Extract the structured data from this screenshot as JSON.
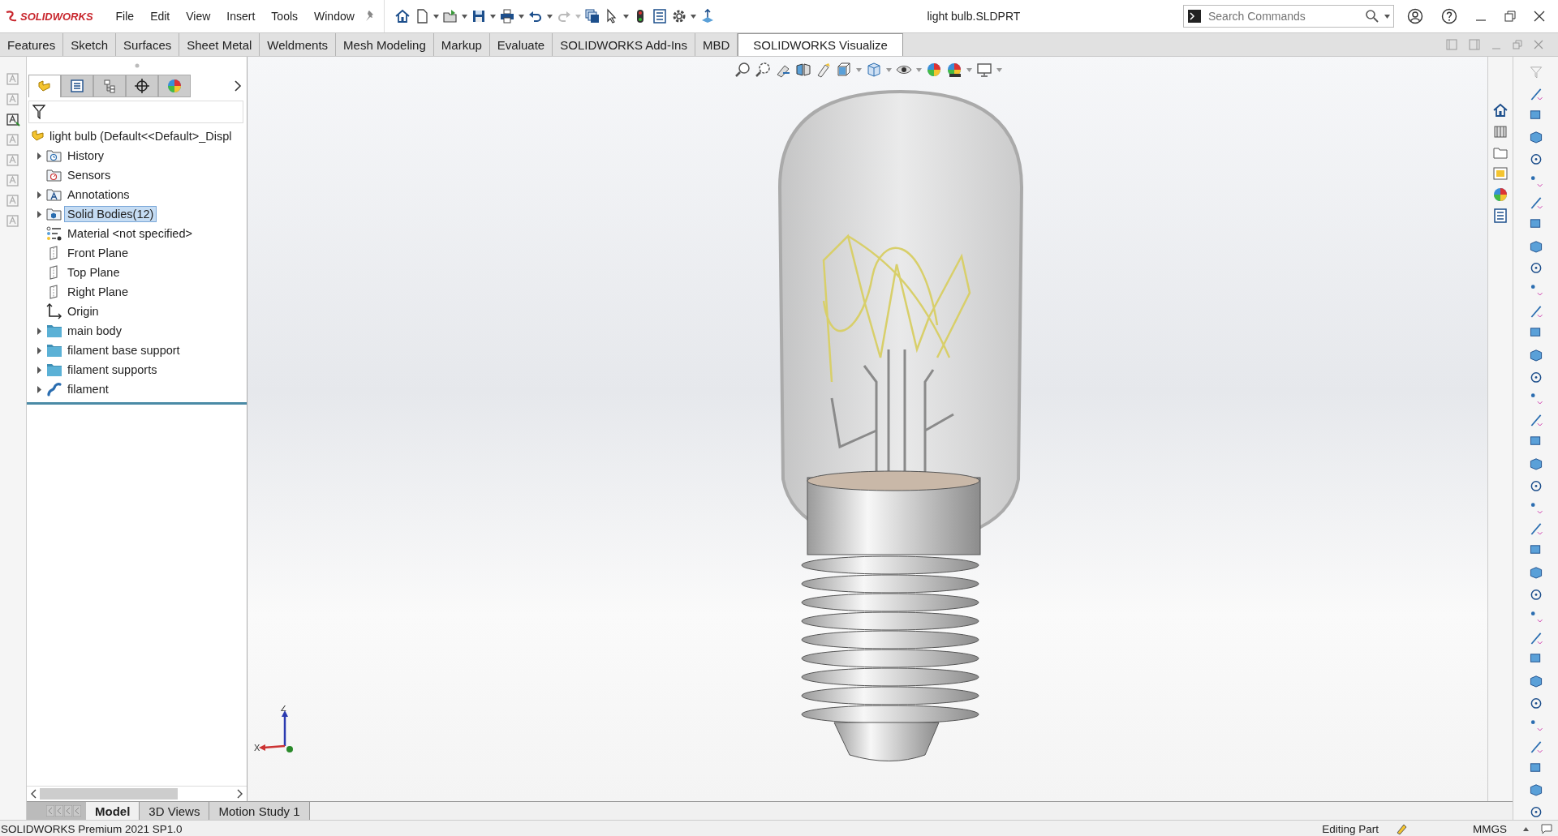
{
  "app": {
    "brand": "SOLIDWORKS",
    "document_title": "light bulb.SLDPRT"
  },
  "menu": [
    "File",
    "Edit",
    "View",
    "Insert",
    "Tools",
    "Window"
  ],
  "search": {
    "placeholder": "Search Commands"
  },
  "command_tabs": [
    {
      "label": "Features",
      "selected": false
    },
    {
      "label": "Sketch",
      "selected": false
    },
    {
      "label": "Surfaces",
      "selected": false
    },
    {
      "label": "Sheet Metal",
      "selected": false
    },
    {
      "label": "Weldments",
      "selected": false
    },
    {
      "label": "Mesh Modeling",
      "selected": false
    },
    {
      "label": "Markup",
      "selected": false
    },
    {
      "label": "Evaluate",
      "selected": false
    },
    {
      "label": "SOLIDWORKS Add-Ins",
      "selected": false
    },
    {
      "label": "MBD",
      "selected": false
    },
    {
      "label": "SOLIDWORKS Visualize",
      "selected": true
    }
  ],
  "panel_tabs": [
    {
      "kind": "feature_tree",
      "selected": true
    },
    {
      "kind": "property_manager",
      "selected": false
    },
    {
      "kind": "configuration_manager",
      "selected": false
    },
    {
      "kind": "dimxpert",
      "selected": false
    },
    {
      "kind": "display_manager",
      "selected": false
    }
  ],
  "feature_tree": {
    "root": "light bulb  (Default<<Default>_Displ",
    "items": [
      {
        "label": "History",
        "kind": "history",
        "expandable": true,
        "selected": false
      },
      {
        "label": "Sensors",
        "kind": "sensors",
        "expandable": false,
        "selected": false
      },
      {
        "label": "Annotations",
        "kind": "annotations",
        "expandable": true,
        "selected": false
      },
      {
        "label": "Solid Bodies(12)",
        "kind": "solid_bodies",
        "expandable": true,
        "selected": true
      },
      {
        "label": "Material <not specified>",
        "kind": "material",
        "expandable": false,
        "selected": false
      },
      {
        "label": "Front Plane",
        "kind": "plane",
        "expandable": false,
        "selected": false
      },
      {
        "label": "Top Plane",
        "kind": "plane",
        "expandable": false,
        "selected": false
      },
      {
        "label": "Right Plane",
        "kind": "plane",
        "expandable": false,
        "selected": false
      },
      {
        "label": "Origin",
        "kind": "origin",
        "expandable": false,
        "selected": false
      },
      {
        "label": "main body",
        "kind": "folder",
        "expandable": true,
        "selected": false
      },
      {
        "label": "filament base support",
        "kind": "folder",
        "expandable": true,
        "selected": false
      },
      {
        "label": "filament supports",
        "kind": "folder",
        "expandable": true,
        "selected": false
      },
      {
        "label": "filament",
        "kind": "curve",
        "expandable": true,
        "selected": false
      }
    ]
  },
  "view_triad": {
    "z_label": "Z",
    "x_label": "X"
  },
  "view_tabs": [
    {
      "label": "Model",
      "selected": true
    },
    {
      "label": "3D Views",
      "selected": false
    },
    {
      "label": "Motion Study 1",
      "selected": false
    }
  ],
  "status_bar": {
    "product": "SOLIDWORKS Premium 2021 SP1.0",
    "mode": "Editing Part",
    "units": "MMGS"
  }
}
